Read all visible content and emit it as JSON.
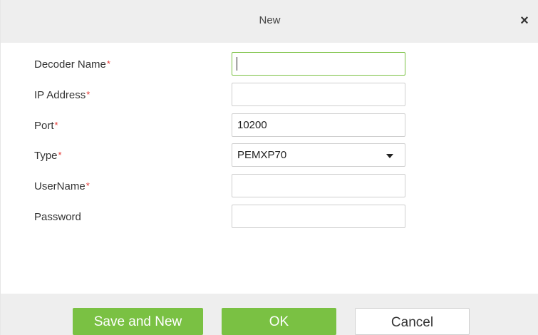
{
  "dialog": {
    "title": "New",
    "close_symbol": "×"
  },
  "form": {
    "required_mark": "*",
    "decoder_name": {
      "label": "Decoder Name",
      "required": true,
      "value": ""
    },
    "ip_address": {
      "label": "IP Address",
      "required": true,
      "value": ""
    },
    "port": {
      "label": "Port",
      "required": true,
      "value": "10200"
    },
    "type": {
      "label": "Type",
      "required": true,
      "value": "PEMXP70"
    },
    "username": {
      "label": "UserName",
      "required": true,
      "value": ""
    },
    "password": {
      "label": "Password",
      "required": false,
      "value": ""
    }
  },
  "buttons": {
    "save_and_new": "Save and New",
    "ok": "OK",
    "cancel": "Cancel"
  },
  "colors": {
    "accent_green": "#7ac143",
    "required_red": "#e53935",
    "header_gray": "#eeeeee"
  },
  "icons": {
    "close": "close-icon",
    "dropdown": "chevron-down-icon"
  }
}
